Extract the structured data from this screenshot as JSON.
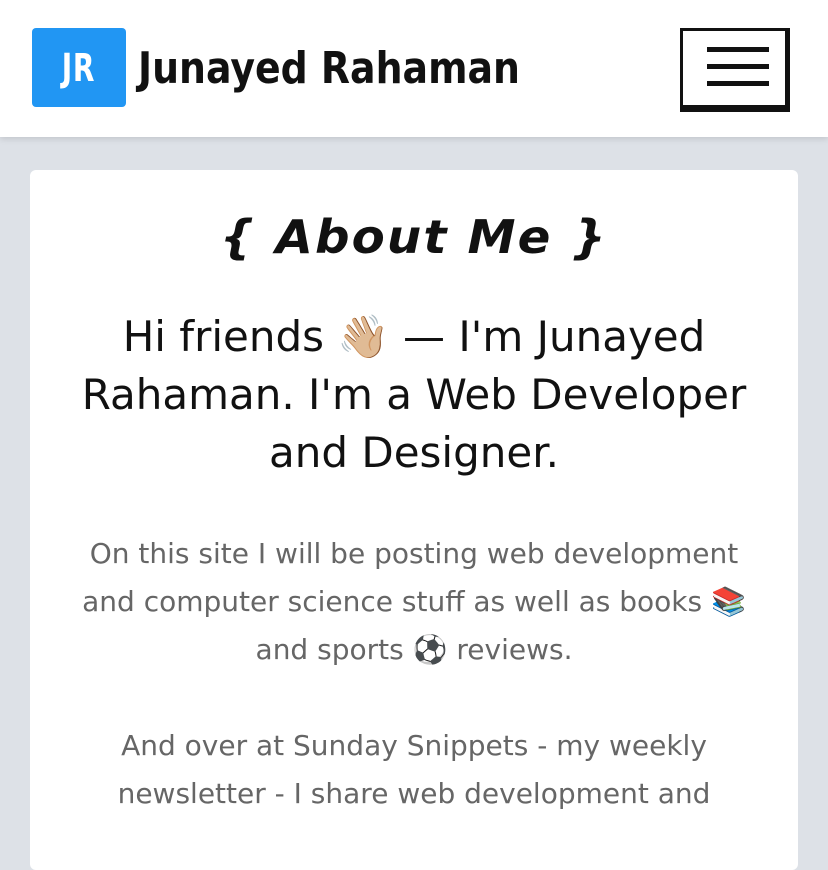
{
  "header": {
    "logo_text": "JR",
    "site_title": "Junayed Rahaman",
    "menu_icon": "hamburger-menu-icon",
    "logo_color": "#2196f3"
  },
  "about": {
    "heading": "{ About Me }",
    "intro_part1": "Hi friends",
    "intro_wave": "👋🏼",
    "intro_part2": "— I'm Junayed Rahaman. I'm a Web Developer and Designer.",
    "description_part1": "On this site I will be posting web development and computer science stuff as well as books",
    "books_emoji": "📚",
    "description_part2": "and sports",
    "sports_emoji": "⚽",
    "description_part3": "reviews.",
    "newsletter_text": "And over at Sunday Snippets - my weekly newsletter - I share web development and"
  },
  "colors": {
    "background": "#dde1e7",
    "card": "#ffffff",
    "heading_text": "#111111",
    "body_text": "#666666"
  }
}
